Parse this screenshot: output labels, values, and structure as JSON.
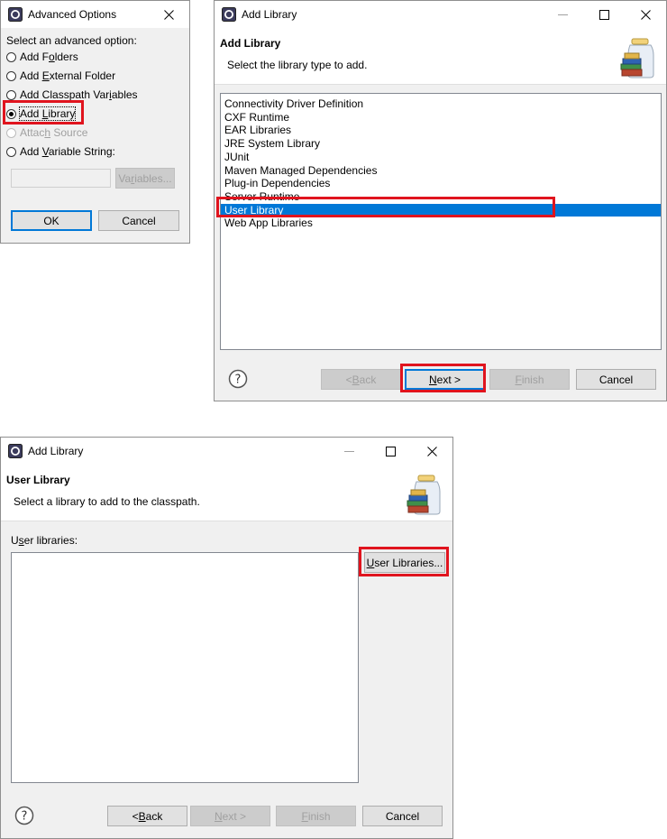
{
  "advanced_options": {
    "title": "Advanced Options",
    "prompt": "Select an advanced option:",
    "options": [
      {
        "label": "Add Folders",
        "checked": false,
        "disabled": false
      },
      {
        "label": "Add External Folder",
        "checked": false,
        "disabled": false
      },
      {
        "label": "Add Classpath Variables",
        "checked": false,
        "disabled": false
      },
      {
        "label": "Add Library",
        "checked": true,
        "disabled": false
      },
      {
        "label": "Attach Source",
        "checked": false,
        "disabled": true
      },
      {
        "label": "Add Variable String:",
        "checked": false,
        "disabled": false
      }
    ],
    "variable_input_value": "",
    "variables_button": "Variables...",
    "ok_button": "OK",
    "cancel_button": "Cancel"
  },
  "add_library_1": {
    "window_title": "Add Library",
    "banner_title": "Add Library",
    "banner_desc": "Select the library type to add.",
    "library_types": [
      "Connectivity Driver Definition",
      "CXF Runtime",
      "EAR Libraries",
      "JRE System Library",
      "JUnit",
      "Maven Managed Dependencies",
      "Plug-in Dependencies",
      "Server Runtime",
      "User Library",
      "Web App Libraries"
    ],
    "selected": "User Library",
    "back_button": "< Back",
    "next_button": "Next >",
    "finish_button": "Finish",
    "cancel_button": "Cancel"
  },
  "add_library_2": {
    "window_title": "Add Library",
    "banner_title": "User Library",
    "banner_desc": "Select a library to add to the classpath.",
    "list_label": "User libraries:",
    "user_libraries_button": "User Libraries...",
    "back_button": "< Back",
    "next_button": "Next >",
    "finish_button": "Finish",
    "cancel_button": "Cancel"
  },
  "colors": {
    "selection": "#0078d7",
    "highlight": "#e0141e"
  },
  "icons": [
    "eclipse-app-icon",
    "close-icon",
    "minimize-icon",
    "maximize-icon",
    "library-jar-icon",
    "help-icon"
  ]
}
